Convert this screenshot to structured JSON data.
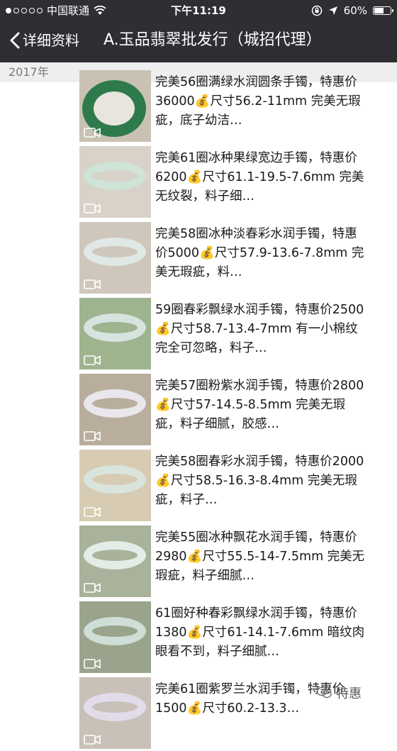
{
  "status_bar": {
    "carrier": "中国联通",
    "time": "下午11:19",
    "battery": "60%",
    "battery_level": 0.6
  },
  "nav": {
    "back_label": "详细资料",
    "title": "A.玉品翡翠批发行（城招代理）"
  },
  "section": {
    "year": "2017年"
  },
  "posts": [
    {
      "text": "完美56圈满绿水润圆条手镯，特惠价36000💰尺寸56.2-11mm 完美无瑕疵，底子幼洁…",
      "bg": "#c9c2b4",
      "bangle": "#2f7a4a"
    },
    {
      "text": "完美61圈冰种果绿宽边手镯，特惠价6200💰尺寸61.1-19.5-7.6mm 完美无纹裂，料子细…",
      "bg": "#d8d2c8",
      "bangle": "#cfe3d6"
    },
    {
      "text": "完美58圈冰种淡春彩水润手镯，特惠价5000💰尺寸57.9-13.6-7.8mm 完美无瑕疵，料…",
      "bg": "#cfc7bc",
      "bangle": "#dfe8e4"
    },
    {
      "text": "59圈春彩飘绿水润手镯，特惠价2500💰尺寸58.7-13.4-7mm 有一小棉纹完全可忽略，料子…",
      "bg": "#9eb48f",
      "bangle": "#d5e4de"
    },
    {
      "text": "完美57圈粉紫水润手镯，特惠价2800💰尺寸57-14.5-8.5mm 完美无瑕疵，料子细腻，胶感…",
      "bg": "#b9ae9e",
      "bangle": "#e9e6ec"
    },
    {
      "text": "完美58圈春彩水润手镯，特惠价2000💰尺寸58.5-16.3-8.4mm 完美无瑕疵，料子…",
      "bg": "#d7cbb3",
      "bangle": "#d9e4dd"
    },
    {
      "text": "完美55圈冰种飘花水润手镯，特惠价2980💰尺寸55.5-14-7.5mm 完美无瑕疵，料子细腻…",
      "bg": "#a9b29a",
      "bangle": "#e3ece6"
    },
    {
      "text": "61圈好种春彩飘绿水润手镯，特惠价1380💰尺寸61-14.1-7.6mm 暗纹肉眼看不到，料子细腻…",
      "bg": "#9aa48c",
      "bangle": "#cfded6"
    },
    {
      "text": "完美61圈紫罗兰水润手镯，特惠价1500💰尺寸60.2-13.3…",
      "bg": "#c9c0b8",
      "bangle": "#e2dcea"
    }
  ],
  "watermark": "特惠"
}
